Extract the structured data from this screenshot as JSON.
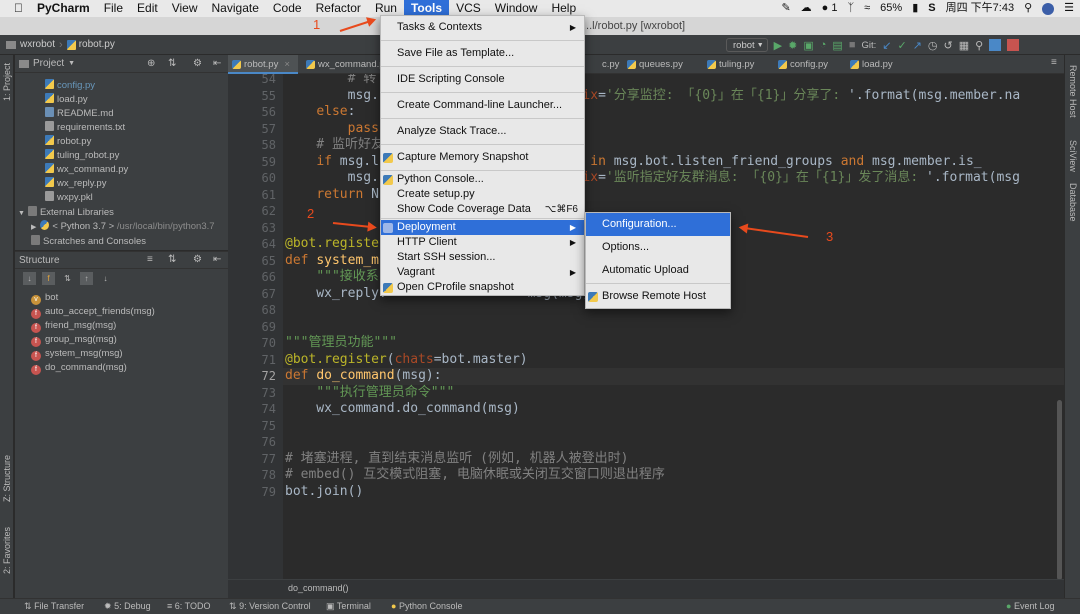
{
  "mac_menu": {
    "app": "PyCharm",
    "items": [
      "File",
      "Edit",
      "View",
      "Navigate",
      "Code",
      "Refactor",
      "Run",
      "Tools",
      "VCS",
      "Window",
      "Help"
    ],
    "active": "Tools",
    "status_right": {
      "count": "1",
      "battery": "65%",
      "datetime": "周四 下午7:43"
    }
  },
  "window_title": "...l/robot.py [wxrobot]",
  "breadcrumb": {
    "project": "wxrobot",
    "file": "robot.py"
  },
  "toolbar": {
    "run_config": "robot",
    "git_label": "Git:"
  },
  "project_panel": {
    "title": "Project",
    "files": [
      "config.py",
      "load.py",
      "README.md",
      "requirements.txt",
      "robot.py",
      "tuling_robot.py",
      "wx_command.py",
      "wx_reply.py",
      "wxpy.pkl"
    ],
    "external_libraries": "External Libraries",
    "python_sdk": "< Python 3.7 >",
    "python_path": "/usr/local/bin/python3.7",
    "scratches": "Scratches and Consoles"
  },
  "structure_panel": {
    "title": "Structure",
    "items": [
      {
        "badge": "v",
        "label": "bot"
      },
      {
        "badge": "f",
        "label": "auto_accept_friends(msg)"
      },
      {
        "badge": "f",
        "label": "friend_msg(msg)"
      },
      {
        "badge": "f",
        "label": "group_msg(msg)"
      },
      {
        "badge": "f",
        "label": "system_msg(msg)"
      },
      {
        "badge": "f",
        "label": "do_command(msg)"
      }
    ]
  },
  "left_strip": {
    "project": "1: Project",
    "structure": "Z: Structure",
    "favorites": "2: Favorites"
  },
  "right_strip": {
    "remote_host": "Remote Host",
    "sciview": "SciView",
    "database": "Database"
  },
  "editor_tabs": [
    "robot.py",
    "wx_command.p",
    "c.py",
    "queues.py",
    "tuling.py",
    "config.py",
    "load.py"
  ],
  "code_lines": [
    {
      "n": "54",
      "text": "        # 转"
    },
    {
      "n": "55",
      "text": "        msg.                      prefix='分享监控: 「{0}」在「{1}」分享了: '.format(msg.member.na"
    },
    {
      "n": "56",
      "text": "    else:"
    },
    {
      "n": "57",
      "text": "        pass"
    },
    {
      "n": "58",
      "text": "    # 监听好友"
    },
    {
      "n": "59",
      "text": "    if msg.l                  msg.chat in msg.bot.listen_friend_groups and msg.member.is_"
    },
    {
      "n": "60",
      "text": "        msg.                      prefix='监听指定好友群消息: 「{0}」在「{1}」发了消息: '.format(msg"
    },
    {
      "n": "61",
      "text": "    return N"
    },
    {
      "n": "62",
      "text": ""
    },
    {
      "n": "63",
      "text": ""
    },
    {
      "n": "64",
      "text": "@bot.registe"
    },
    {
      "n": "65",
      "text": "def system_m"
    },
    {
      "n": "66",
      "text": "    \"\"\"接收系"
    },
    {
      "n": "67",
      "text": "    wx_reply.                  msg(msg)"
    },
    {
      "n": "68",
      "text": ""
    },
    {
      "n": "69",
      "text": ""
    },
    {
      "n": "70",
      "text": "\"\"\"管理员功能\"\"\""
    },
    {
      "n": "71",
      "text": "@bot.register(chats=bot.master)"
    },
    {
      "n": "72",
      "text": "def do_command(msg):"
    },
    {
      "n": "73",
      "text": "    \"\"\"执行管理员命令\"\"\""
    },
    {
      "n": "74",
      "text": "    wx_command.do_command(msg)"
    },
    {
      "n": "75",
      "text": ""
    },
    {
      "n": "76",
      "text": ""
    },
    {
      "n": "77",
      "text": "# 堵塞进程, 直到结束消息监听 (例如, 机器人被登出时)"
    },
    {
      "n": "78",
      "text": "# embed() 互交模式阻塞, 电脑休眠或关闭互交窗口则退出程序"
    },
    {
      "n": "79",
      "text": "bot.join()"
    }
  ],
  "current_line": "72",
  "editor_breadcrumb": "do_command()",
  "tools_menu": [
    {
      "label": "Tasks & Contexts",
      "arrow": true
    },
    {
      "sep": true
    },
    {
      "label": "Save File as Template..."
    },
    {
      "sep": true
    },
    {
      "label": "IDE Scripting Console"
    },
    {
      "sep": true
    },
    {
      "label": "Create Command-line Launcher..."
    },
    {
      "sep": true
    },
    {
      "label": "Analyze Stack Trace..."
    },
    {
      "sep": true
    },
    {
      "label": "Capture Memory Snapshot",
      "icon": true
    },
    {
      "sep": true
    },
    {
      "label": "Python Console...",
      "icon": true,
      "small": true
    },
    {
      "label": "Create setup.py",
      "small": true
    },
    {
      "label": "Show Code Coverage Data",
      "shortcut": "⌥⌘F6",
      "small": true
    },
    {
      "sep": true
    },
    {
      "label": "Deployment",
      "arrow": true,
      "icon": true,
      "highlighted": true,
      "small": true
    },
    {
      "label": "HTTP Client",
      "arrow": true,
      "small": true
    },
    {
      "label": "Start SSH session...",
      "small": true
    },
    {
      "label": "Vagrant",
      "arrow": true,
      "small": true
    },
    {
      "label": "Open CProfile snapshot",
      "icon": true,
      "small": true
    }
  ],
  "deployment_submenu": [
    {
      "label": "Configuration...",
      "highlighted": true
    },
    {
      "label": "Options..."
    },
    {
      "label": "Automatic Upload"
    },
    {
      "sep": true
    },
    {
      "label": "Browse Remote Host",
      "icon": true
    }
  ],
  "annotations": [
    "1",
    "2",
    "3"
  ],
  "status_bar": {
    "items": [
      "File Transfer",
      "5: Debug",
      "6: TODO",
      "9: Version Control",
      "Terminal",
      "Python Console"
    ],
    "event_log": "Event Log"
  },
  "colors": {
    "accent": "#2f6fd8",
    "annotation": "#e84a1d",
    "keyword": "#cc7832",
    "string": "#6a8759",
    "decorator": "#bbb529",
    "comment": "#808080"
  }
}
